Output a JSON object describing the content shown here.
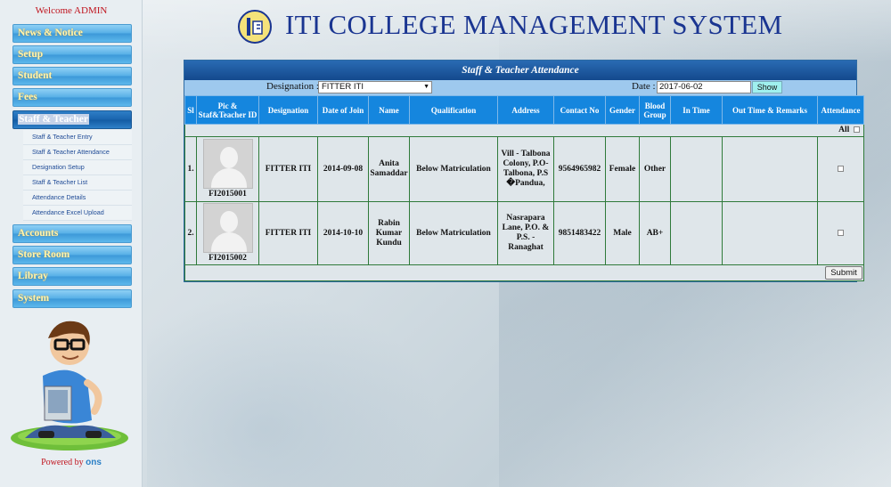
{
  "sidebar": {
    "welcome": "Welcome ADMIN",
    "menu": [
      {
        "label": "News & Notice"
      },
      {
        "label": "Setup"
      },
      {
        "label": "Student"
      },
      {
        "label": "Fees"
      },
      {
        "label": "Staff & Teacher",
        "active": true
      },
      {
        "label": "Accounts"
      },
      {
        "label": "Store Room"
      },
      {
        "label": "Libray"
      },
      {
        "label": "System"
      }
    ],
    "submenu": [
      {
        "label": "Staff & Teacher Entry"
      },
      {
        "label": "Staff & Teacher Attendance"
      },
      {
        "label": "Designation Setup"
      },
      {
        "label": "Staff & Teacher List"
      },
      {
        "label": "Attendance Details"
      },
      {
        "label": "Attendance Excel Upload"
      }
    ],
    "powered_by": "Powered by",
    "powered_brand": "ons"
  },
  "header": {
    "title": "ITI COLLEGE MANAGEMENT SYSTEM"
  },
  "panel": {
    "title": "Staff & Teacher Attendance",
    "designation_label": "Designation :",
    "designation_value": "FITTER ITI",
    "date_label": "Date :",
    "date_value": "2017-06-02",
    "show_label": "Show",
    "all_label": "All",
    "submit_label": "Submit",
    "columns": [
      "Sl",
      "Pic & Staf&Teacher ID",
      "Designation",
      "Date of Join",
      "Name",
      "Qualification",
      "Address",
      "Contact No",
      "Gender",
      "Blood Group",
      "In Time",
      "Out Time & Remarks",
      "Attendance"
    ],
    "rows": [
      {
        "sl": "1.",
        "id": "FI2015001",
        "designation": "FITTER ITI",
        "date_of_join": "2014-09-08",
        "name": "Anita Samaddar",
        "qualification": "Below Matriculation",
        "address": "Vill - Talbona Colony, P.O-Talbona, P.S �Pandua,",
        "contact": "9564965982",
        "gender": "Female",
        "blood_group": "Other",
        "in_time": "",
        "out_time": ""
      },
      {
        "sl": "2.",
        "id": "FI2015002",
        "designation": "FITTER ITI",
        "date_of_join": "2014-10-10",
        "name": "Rabin Kumar Kundu",
        "qualification": "Below Matriculation",
        "address": "Nasrapara Lane, P.O. & P.S. - Ranaghat",
        "contact": "9851483422",
        "gender": "Male",
        "blood_group": "AB+",
        "in_time": "",
        "out_time": ""
      }
    ]
  }
}
